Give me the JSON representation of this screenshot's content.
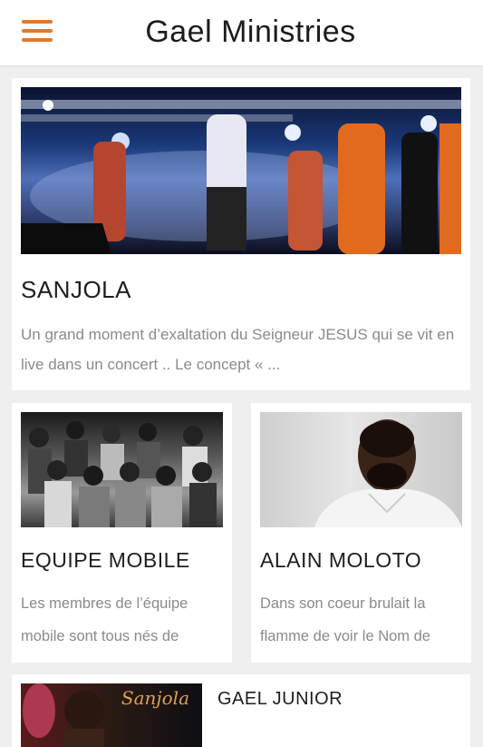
{
  "header": {
    "title": "Gael Ministries",
    "menu_icon": "hamburger-menu-icon",
    "accent_color": "#e07a2e"
  },
  "cards": {
    "featured": {
      "title": "SANJOLA",
      "description": "Un grand moment d’exaltation du Seigneur JESUS qui se vit en live dans un concert .. Le concept « ..."
    },
    "equipe": {
      "title": "EQUIPE MOBILE",
      "description": "Les membres de l’équipe mobile sont tous nés de"
    },
    "alain": {
      "title": "ALAIN MOLOTO",
      "description": "Dans son coeur brulait la flamme de voir le Nom de"
    },
    "gael": {
      "title": "GAEL JUNIOR",
      "image_text": "Sanjola"
    }
  }
}
